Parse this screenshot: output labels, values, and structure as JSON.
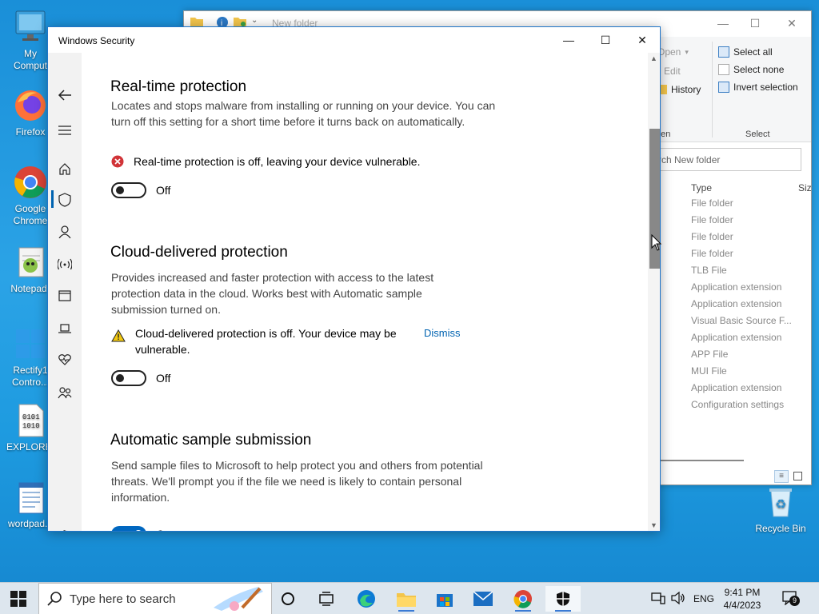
{
  "desktop": {
    "icons": [
      {
        "label": "My\nComput"
      },
      {
        "label": "Firefox"
      },
      {
        "label": "Google\nChrome"
      },
      {
        "label": "Notepad-"
      },
      {
        "label": "Rectify1\nContro..."
      },
      {
        "label": "EXPLORER"
      },
      {
        "label": "wordpad.e"
      },
      {
        "label": "Recycle Bin"
      }
    ]
  },
  "explorer": {
    "title": "New folder",
    "ribbon": {
      "open": "Open",
      "edit": "Edit",
      "history": "History",
      "open_section": "pen",
      "select_all": "Select all",
      "select_none": "Select none",
      "invert_selection": "Invert selection",
      "select_section": "Select"
    },
    "search_placeholder": "rch New folder",
    "columns": {
      "type": "Type",
      "size": "Siz"
    },
    "types": [
      "File folder",
      "File folder",
      "File folder",
      "File folder",
      "TLB File",
      "Application extension",
      "Application extension",
      "Visual Basic Source F...",
      "Application extension",
      "APP File",
      "MUI File",
      "Application extension",
      "Configuration settings"
    ]
  },
  "security": {
    "window_title": "Windows Security",
    "sections": [
      {
        "heading": "Real-time protection",
        "description": "Locates and stops malware from installing or running on your device. You can turn off this setting for a short time before it turns back on automatically.",
        "status": "Real-time protection is off, leaving your device vulnerable.",
        "toggle_label": "Off"
      },
      {
        "heading": "Cloud-delivered protection",
        "description": "Provides increased and faster protection with access to the latest protection data in the cloud. Works best with Automatic sample submission turned on.",
        "status": "Cloud-delivered protection is off. Your device may be vulnerable.",
        "dismiss": "Dismiss",
        "toggle_label": "Off"
      },
      {
        "heading": "Automatic sample submission",
        "description": "Send sample files to Microsoft to help protect you and others from potential threats. We'll prompt you if the file we need is likely to contain personal information.",
        "toggle_label": "On"
      }
    ]
  },
  "taskbar": {
    "search_placeholder": "Type here to search",
    "language": "ENG",
    "time": "9:41 PM",
    "date": "4/4/2023",
    "notifications": "9"
  },
  "colors": {
    "accent": "#0067c0",
    "error": "#d13438",
    "warning": "#f2c811"
  }
}
